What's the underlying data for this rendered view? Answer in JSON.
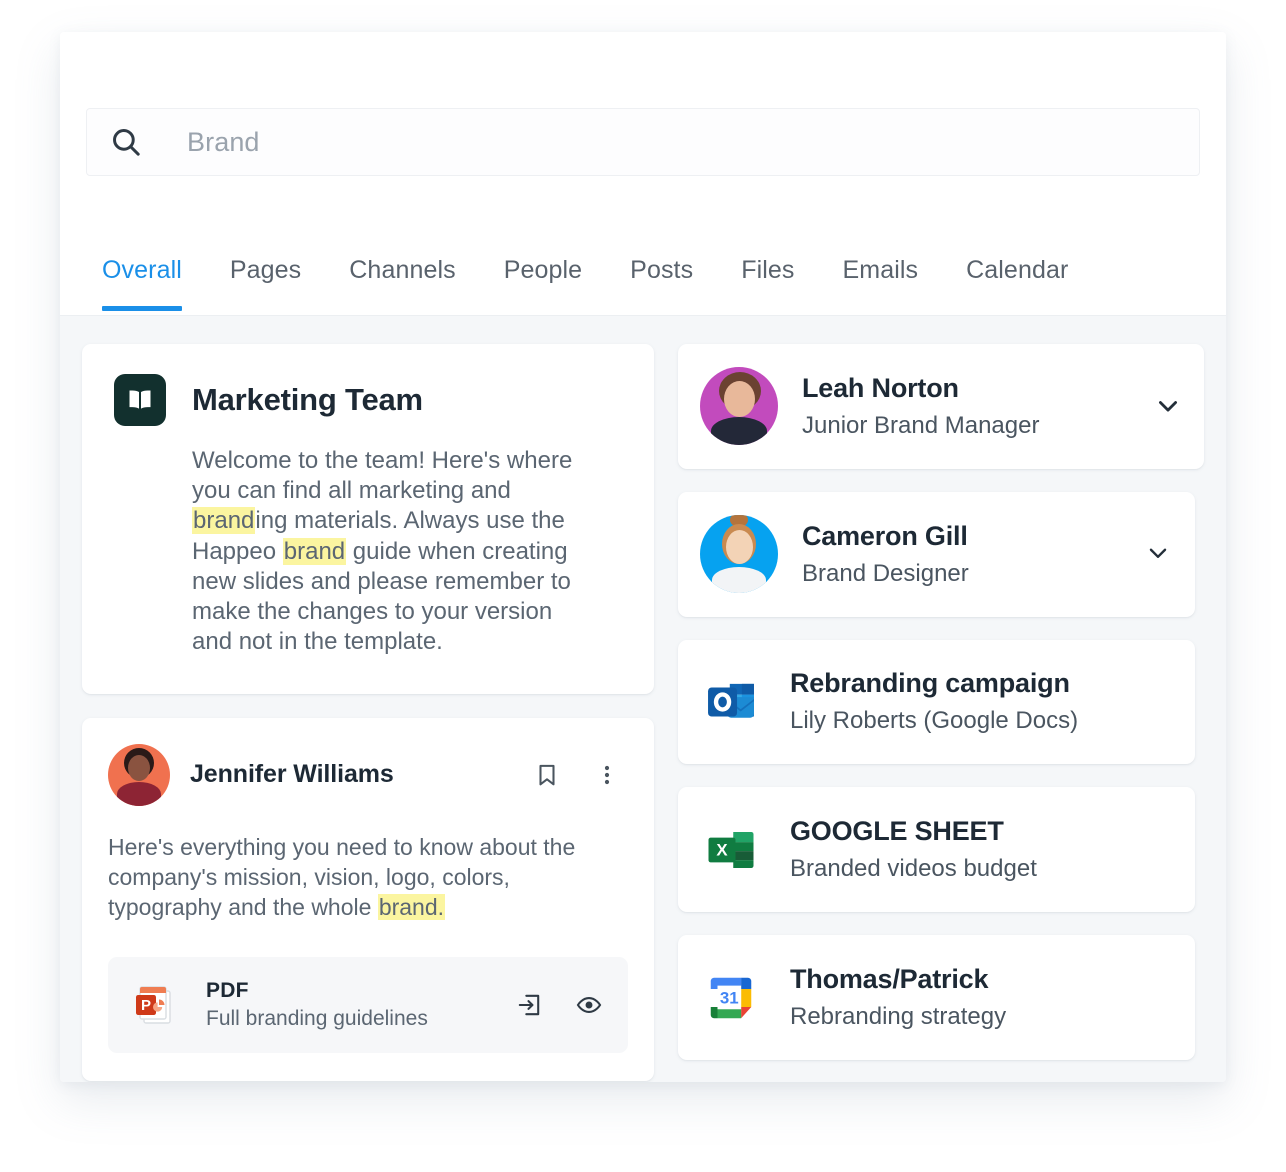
{
  "search": {
    "placeholder": "Brand",
    "value": "",
    "icon": "search-icon"
  },
  "tabs": [
    {
      "label": "Overall",
      "active": true
    },
    {
      "label": "Pages",
      "active": false
    },
    {
      "label": "Channels",
      "active": false
    },
    {
      "label": "People",
      "active": false
    },
    {
      "label": "Posts",
      "active": false
    },
    {
      "label": "Files",
      "active": false
    },
    {
      "label": "Emails",
      "active": false
    },
    {
      "label": "Calendar",
      "active": false
    }
  ],
  "team_card": {
    "icon": "open-book-icon",
    "icon_bg": "#12302e",
    "title": "Marketing Team",
    "body_parts": [
      {
        "text": "Welcome to the team! Here's where you can find all marketing and ",
        "highlight": false
      },
      {
        "text": "brand",
        "highlight": true
      },
      {
        "text": "ing materials. Always use the Happeo ",
        "highlight": false
      },
      {
        "text": "brand",
        "highlight": true
      },
      {
        "text": " guide when creating new slides and please remember to make the changes to your version and not in the template.",
        "highlight": false
      }
    ]
  },
  "post_card": {
    "author": "Jennifer Williams",
    "avatar_bg": "#f0714f",
    "bookmark_icon": "bookmark-icon",
    "more_icon": "more-vertical-icon",
    "text_parts": [
      {
        "text": "Here's everything you need to know about the company's mission, vision, logo, colors, typography and the whole ",
        "highlight": false
      },
      {
        "text": "brand.",
        "highlight": true
      }
    ],
    "attachment": {
      "icon": "powerpoint-file-icon",
      "type": "PDF",
      "name": "Full branding guidelines",
      "open_icon": "open-in-icon",
      "preview_icon": "eye-icon"
    }
  },
  "results": [
    {
      "kind": "person",
      "name": "Leah Norton",
      "subtitle": "Junior Brand Manager",
      "avatar_bg": "#c24bbd",
      "chevron_icon": "chevron-down-icon"
    },
    {
      "kind": "person",
      "name": "Cameron Gill",
      "subtitle": "Brand Designer",
      "avatar_bg": "#06a2f0",
      "chevron_icon": "chevron-down-icon"
    },
    {
      "kind": "doc",
      "icon": "outlook-icon",
      "name": "Rebranding campaign",
      "subtitle": "Lily Roberts (Google Docs)"
    },
    {
      "kind": "doc",
      "icon": "excel-icon",
      "name": "GOOGLE SHEET",
      "subtitle": "Branded videos budget"
    },
    {
      "kind": "doc",
      "icon": "google-calendar-icon",
      "name": "Thomas/Patrick",
      "subtitle": "Rebranding strategy"
    }
  ],
  "colors": {
    "accent": "#1a8fe8",
    "highlight": "#fbf5a0",
    "page_bg": "#f5f7f9",
    "text_primary": "#1d2935",
    "text_secondary": "#5b6672"
  }
}
